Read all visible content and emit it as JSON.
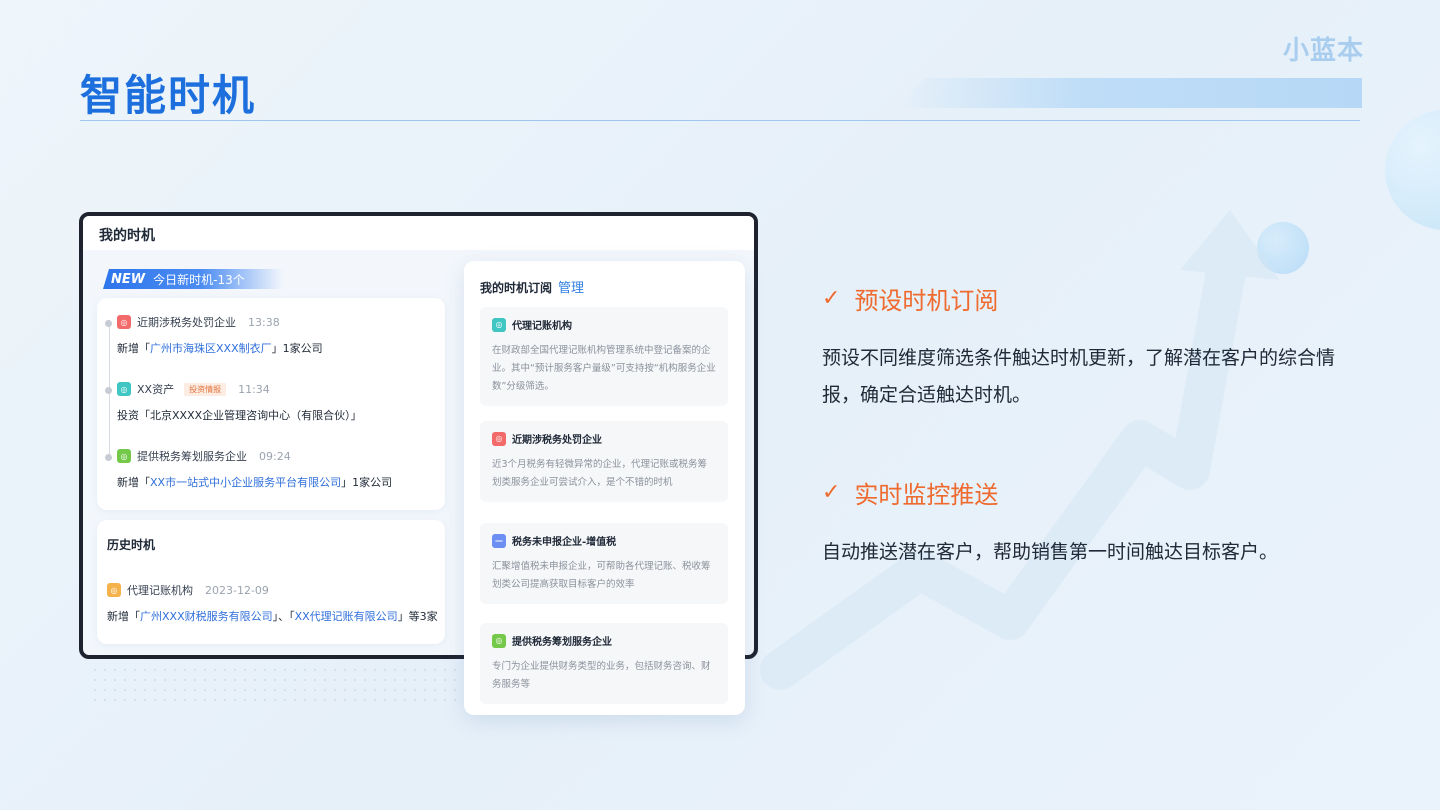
{
  "brand": "小蓝本",
  "title": "智能时机",
  "panel": {
    "header": "我的时机",
    "new_badge": {
      "new": "NEW",
      "text": "今日新时机-13个"
    },
    "today_items": [
      {
        "icon": "red-square-icon",
        "label": "近期涉税务处罚企业",
        "time": "13:38",
        "prefix": "新增「",
        "link": "广州市海珠区XXX制衣厂",
        "suffix": "」1家公司"
      },
      {
        "icon": "teal-square-icon",
        "label": "XX资产",
        "tag": "投资情报",
        "time": "11:34",
        "text": "投资「北京XXXX企业管理咨询中心（有限合伙）」"
      },
      {
        "icon": "green-square-icon",
        "label": "提供税务筹划服务企业",
        "time": "09:24",
        "prefix": "新增「",
        "link": "XX市一站式中小企业服务平台有限公司",
        "suffix": "」1家公司"
      }
    ],
    "history": {
      "title": "历史时机",
      "item": {
        "label": "代理记账机构",
        "date": "2023-12-09",
        "prefix": "新增「",
        "link1": "广州XXX财税服务有限公司",
        "mid": "」、「",
        "link2": "XX代理记账有限公司",
        "suffix": "」等3家"
      }
    }
  },
  "subscription": {
    "title": "我的时机订阅",
    "manage": "管理",
    "cards": [
      {
        "title": "代理记账机构",
        "desc": "在财政部全国代理记账机构管理系统中登记备案的企业。其中“预计服务客户量级”可支持按“机构服务企业数”分级筛选。"
      },
      {
        "title": "近期涉税务处罚企业",
        "desc": "近3个月税务有轻微异常的企业，代理记账或税务筹划类服务企业可尝试介入，是个不错的时机"
      },
      {
        "title": "税务未申报企业-增值税",
        "desc": "汇聚增值税未申报企业，可帮助各代理记账、税收筹划类公司提高获取目标客户的效率"
      },
      {
        "title": "提供税务筹划服务企业",
        "desc": "专门为企业提供财务类型的业务，包括财务咨询、财务服务等"
      }
    ]
  },
  "features": [
    {
      "check": "✓",
      "title": "预设时机订阅",
      "desc": "预设不同维度筛选条件触达时机更新，了解潜在客户的综合情报，确定合适触达时机。"
    },
    {
      "check": "✓",
      "title": "实时监控推送",
      "desc": "自动推送潜在客户，帮助销售第一时间触达目标客户。"
    }
  ],
  "colors": {
    "accent": "#1c6fdc",
    "orange": "#ee6a2f",
    "link": "#2f6fdb"
  }
}
